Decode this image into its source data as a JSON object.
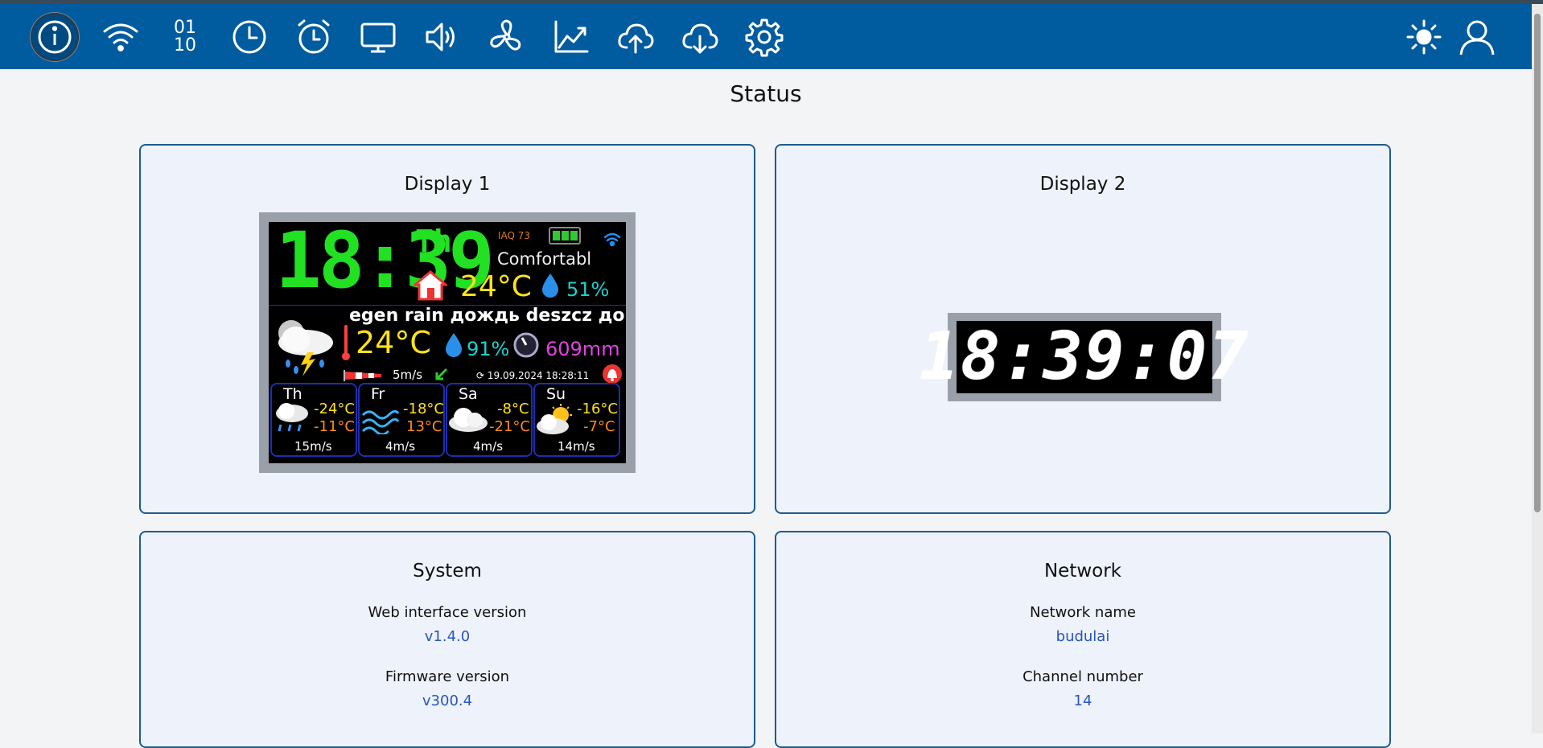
{
  "nav": {
    "icons": [
      "info-icon",
      "wifi-icon",
      "binary-icon",
      "clock-icon",
      "alarm-icon",
      "monitor-icon",
      "speaker-icon",
      "fan-icon",
      "chart-icon",
      "cloud-upload-icon",
      "cloud-download-icon",
      "gear-icon",
      "brightness-icon",
      "user-icon"
    ],
    "binary_top": "01",
    "binary_bottom": "10"
  },
  "page": {
    "title": "Status"
  },
  "display1": {
    "title": "Display 1",
    "screen": {
      "time": "18:39",
      "day": "Th",
      "iaq": "IAQ 73",
      "comfort": "Comfortabl",
      "indoor_temp": "24°C",
      "indoor_humidity": "51%",
      "ticker": "egen rain дождь deszcz дощ",
      "outdoor_temp": "24°C",
      "outdoor_humidity": "91%",
      "precip": "609mm",
      "wind": "5m/s",
      "updated": "19.09.2024 18:28:11",
      "forecast": [
        {
          "day": "Th",
          "high": "-24°C",
          "low": "-11°C",
          "wind": "15m/s"
        },
        {
          "day": "Fr",
          "high": "-18°C",
          "low": "13°C",
          "wind": "4m/s"
        },
        {
          "day": "Sa",
          "high": "-8°C",
          "low": "-21°C",
          "wind": "4m/s"
        },
        {
          "day": "Su",
          "high": "-16°C",
          "low": "-7°C",
          "wind": "14m/s"
        }
      ]
    }
  },
  "display2": {
    "title": "Display 2",
    "clock": "18:39:07"
  },
  "system": {
    "title": "System",
    "web_label": "Web interface version",
    "web_value": "v1.4.0",
    "fw_label": "Firmware version",
    "fw_value": "v300.4"
  },
  "network": {
    "title": "Network",
    "name_label": "Network name",
    "name_value": "budulai",
    "channel_label": "Channel number",
    "channel_value": "14"
  },
  "colors": {
    "navbar": "#005b9f",
    "card_border": "#1f5c8c",
    "value_blue": "#2a55b8",
    "seg_green": "#22e022"
  }
}
